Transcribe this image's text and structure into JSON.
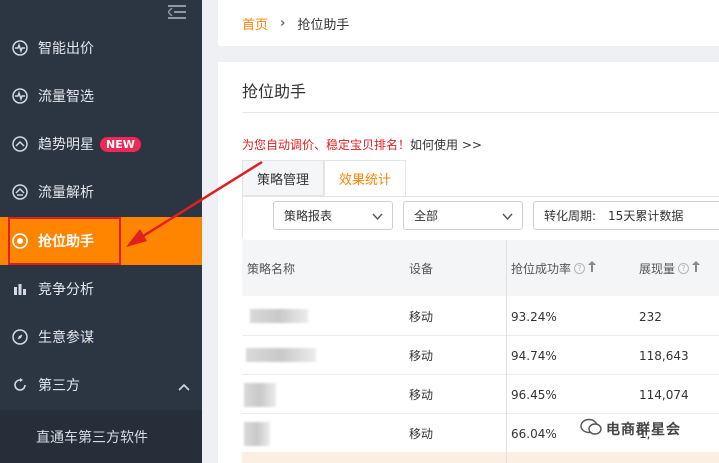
{
  "sidebar": {
    "items": [
      {
        "label": "智能出价",
        "icon": "pulse-icon"
      },
      {
        "label": "流量智选",
        "icon": "pulse-icon"
      },
      {
        "label": "趋势明星",
        "icon": "trend-star-icon",
        "badge": "NEW"
      },
      {
        "label": "流量解析",
        "icon": "flow-icon"
      },
      {
        "label": "抢位助手",
        "icon": "target-icon",
        "active": true
      },
      {
        "label": "竞争分析",
        "icon": "bar-chart-icon"
      },
      {
        "label": "生意参谋",
        "icon": "compass-icon"
      },
      {
        "label": "第三方",
        "icon": "refresh-icon",
        "expanded": true
      }
    ],
    "subitem": "直通车第三方软件",
    "accent": "#ff8400",
    "bg": "#2c3542"
  },
  "breadcrumb": {
    "home": "首页",
    "current": "抢位助手"
  },
  "card": {
    "title": "抢位助手",
    "promo_red": "为您自动调价、稳定宝贝排名！",
    "promo_link": "如何使用 >>"
  },
  "tabs": [
    {
      "label": "策略管理"
    },
    {
      "label": "效果统计",
      "active": true
    }
  ],
  "filters": {
    "report": "策略报表",
    "scope": "全部",
    "period_label": "转化周期:",
    "period_value": "15天累计数据"
  },
  "table": {
    "headers": [
      "策略名称",
      "设备",
      "抢位成功率",
      "展现量"
    ],
    "rows": [
      {
        "device": "移动",
        "rate": "93.24%",
        "impressions": "232"
      },
      {
        "device": "移动",
        "rate": "94.74%",
        "impressions": "118,643"
      },
      {
        "device": "移动",
        "rate": "96.45%",
        "impressions": "114,074"
      },
      {
        "device": "移动",
        "rate": "66.04%",
        "impressions": "1,"
      }
    ]
  },
  "watermark": "电商群星会"
}
